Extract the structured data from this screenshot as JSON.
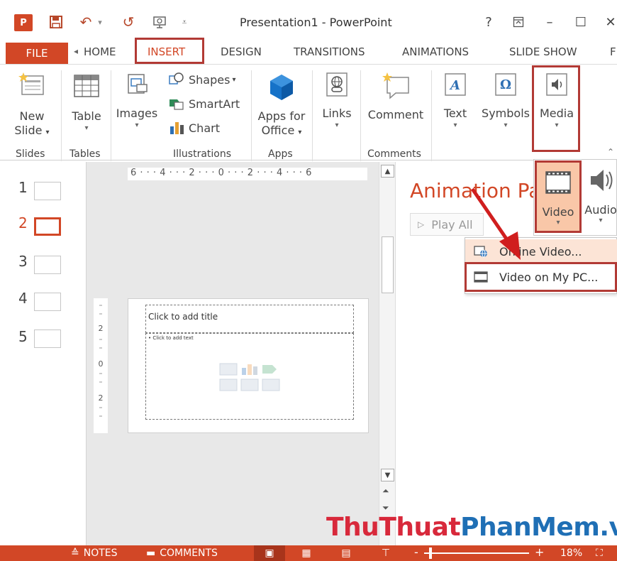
{
  "window": {
    "title": "Presentation1 - PowerPoint",
    "app_logo": "P",
    "help": "?",
    "ribbon_display": "ribbon-display-icon",
    "minimize": "–",
    "maximize": "☐",
    "close": "✕"
  },
  "qat": {
    "undo": "↶",
    "redo": "↺",
    "customize": "▾"
  },
  "tabs": {
    "file": "FILE",
    "home": "HOME",
    "insert": "INSERT",
    "design": "DESIGN",
    "transitions": "TRANSITIONS",
    "animations": "ANIMATIONS",
    "slideshow": "SLIDE SHOW",
    "review_partial": "F"
  },
  "ribbon": {
    "new_slide": "New",
    "new_slide_2": "Slide",
    "table": "Table",
    "images": "Images",
    "shapes": "Shapes",
    "smartart": "SmartArt",
    "chart": "Chart",
    "apps_for": "Apps for",
    "apps_office": "Office",
    "links": "Links",
    "comment": "Comment",
    "text": "Text",
    "symbols": "Symbols",
    "media": "Media",
    "groups": {
      "slides": "Slides",
      "tables": "Tables",
      "illustrations": "Illustrations",
      "apps": "Apps",
      "comments": "Comments"
    }
  },
  "media_dropdown": {
    "video": "Video",
    "audio": "Audio"
  },
  "video_menu": {
    "online_video": "Online Video...",
    "video_on_pc": "Video on My PC..."
  },
  "thumbnails": [
    "1",
    "2",
    "3",
    "4",
    "5"
  ],
  "ruler": {
    "horizontal": "6 · · · 4 · · · 2 · · · 0 · · · 2 · · · 4 · · · 6"
  },
  "slide": {
    "title_placeholder": "Click to add title",
    "body_placeholder": "• Click to add text"
  },
  "animation_pane": {
    "title": "Animation Pa",
    "play_all": "Play All"
  },
  "statusbar": {
    "notes": "NOTES",
    "comments": "COMMENTS",
    "zoom_minus": "-",
    "zoom_plus": "+",
    "zoom": "18%"
  },
  "watermark": {
    "part1": "ThuThuat",
    "part2": "PhanMem.vn"
  },
  "colors": {
    "accent": "#d24726",
    "highlight_box": "#b23a35",
    "video_hover": "#f9c7a8"
  }
}
